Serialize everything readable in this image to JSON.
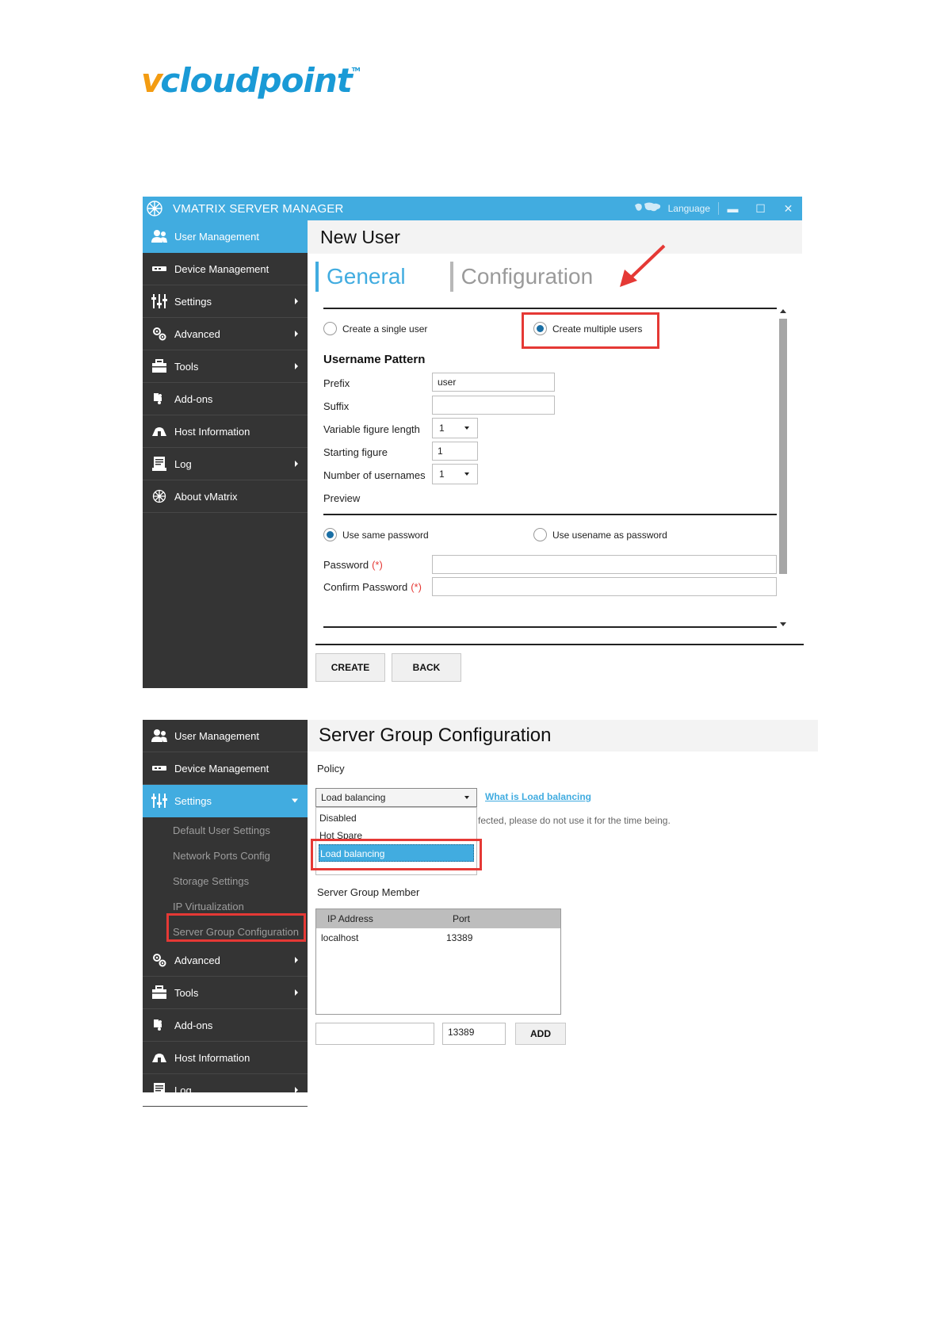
{
  "logo": {
    "v": "v",
    "text": "cloudpoint",
    "tm": "TM"
  },
  "window1": {
    "title": "VMATRIX SERVER MANAGER",
    "language": "Language",
    "sidebar": [
      {
        "label": "User Management",
        "icon": "users-icon",
        "arrow": false,
        "active": true
      },
      {
        "label": "Device Management",
        "icon": "device-icon",
        "arrow": false
      },
      {
        "label": "Settings",
        "icon": "sliders-icon",
        "arrow": true
      },
      {
        "label": "Advanced",
        "icon": "gears-icon",
        "arrow": true
      },
      {
        "label": "Tools",
        "icon": "toolbox-icon",
        "arrow": true
      },
      {
        "label": "Add-ons",
        "icon": "puzzle-icon",
        "arrow": false
      },
      {
        "label": "Host Information",
        "icon": "host-icon",
        "arrow": false
      },
      {
        "label": "Log",
        "icon": "log-icon",
        "arrow": true
      },
      {
        "label": "About vMatrix",
        "icon": "vmatrix-icon",
        "arrow": false
      }
    ],
    "page_title": "New User",
    "tabs": {
      "general": "General",
      "configuration": "Configuration"
    },
    "mode": {
      "single": "Create a single user",
      "multiple": "Create multiple users",
      "selected": "multiple"
    },
    "pattern_heading": "Username Pattern",
    "fields": {
      "prefix_label": "Prefix",
      "prefix_value": "user",
      "suffix_label": "Suffix",
      "suffix_value": "",
      "var_len_label": "Variable figure length",
      "var_len_value": "1",
      "start_label": "Starting figure",
      "start_value": "1",
      "count_label": "Number of usernames",
      "count_value": "1",
      "preview_label": "Preview"
    },
    "password_mode": {
      "same": "Use same password",
      "username": "Use usename as password",
      "selected": "same"
    },
    "password_label": "Password",
    "confirm_label": "Confirm Password",
    "required_mark": "(*)",
    "buttons": {
      "create": "CREATE",
      "back": "BACK"
    }
  },
  "window2": {
    "sidebar_top": [
      {
        "label": "User Management",
        "icon": "users-icon"
      },
      {
        "label": "Device Management",
        "icon": "device-icon"
      }
    ],
    "settings_label": "Settings",
    "submenu": [
      "Default User Settings",
      "Network Ports Config",
      "Storage Settings",
      "IP Virtualization",
      "Server Group Configuration"
    ],
    "sidebar_bottom": [
      {
        "label": "Advanced",
        "icon": "gears-icon",
        "arrow": true
      },
      {
        "label": "Tools",
        "icon": "toolbox-icon",
        "arrow": true
      },
      {
        "label": "Add-ons",
        "icon": "puzzle-icon",
        "arrow": false
      },
      {
        "label": "Host Information",
        "icon": "host-icon",
        "arrow": false
      },
      {
        "label": "Log",
        "icon": "log-icon",
        "arrow": true
      }
    ],
    "page_title": "Server Group Configuration",
    "policy_label": "Policy",
    "policy_value": "Load balancing",
    "policy_options": [
      "Disabled",
      "Hot Spare",
      "Load balancing"
    ],
    "policy_link": "What is Load balancing",
    "policy_note": "fected, please do not use it for the time being.",
    "member_label": "Server Group Member",
    "table": {
      "headers": [
        "IP Address",
        "Port"
      ],
      "rows": [
        [
          "localhost",
          "13389"
        ]
      ]
    },
    "ip_input": "",
    "port_input": "13389",
    "add_button": "ADD"
  },
  "colors": {
    "accent": "#41ace0",
    "sidebar": "#343434",
    "highlight": "#e53935"
  }
}
